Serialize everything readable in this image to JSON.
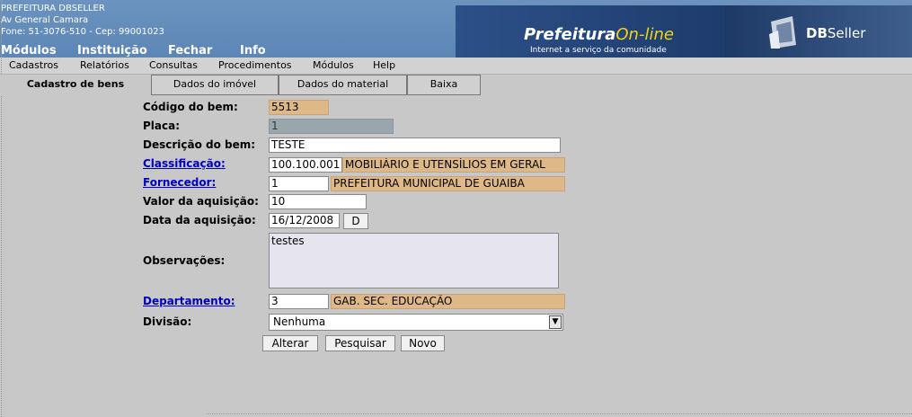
{
  "org": {
    "name": "PREFEITURA DBSELLER",
    "address": "Av General Camara",
    "contact": "Fone: 51-3076-510  -  Cep: 99001023"
  },
  "top_menu": [
    "Módulos",
    "Instituição",
    "Fechar",
    "Info"
  ],
  "logos": {
    "prefeitura_main": "Prefeitura",
    "prefeitura_accent": "On-line",
    "prefeitura_tagline": "Internet a serviço da comunidade",
    "dbseller_bold": "DB",
    "dbseller_rest": "Seller"
  },
  "menu_bar": [
    "Cadastros",
    "Relatórios",
    "Consultas",
    "Procedimentos",
    "Módulos",
    "Help"
  ],
  "tabs": [
    {
      "label": "Cadastro de bens",
      "active": true
    },
    {
      "label": "Dados do imóvel",
      "active": false
    },
    {
      "label": "Dados do material",
      "active": false
    },
    {
      "label": "Baixa",
      "active": false
    }
  ],
  "form": {
    "codigo": {
      "label": "Código do bem:",
      "value": "5513"
    },
    "placa": {
      "label": "Placa:",
      "value": "1"
    },
    "descricao": {
      "label": "Descrição do bem:",
      "value": "TESTE"
    },
    "classificacao": {
      "label": "Classificação:",
      "code": "100.100.001",
      "desc": "MOBILIÁRIO E UTENSÍLIOS EM GERAL"
    },
    "fornecedor": {
      "label": "Fornecedor:",
      "code": "1",
      "desc": "PREFEITURA MUNICIPAL DE GUAIBA"
    },
    "valor": {
      "label": "Valor da aquisição:",
      "value": "10"
    },
    "data": {
      "label": "Data da aquisição:",
      "value": "16/12/2008",
      "button": "D"
    },
    "observacoes": {
      "label": "Observações:",
      "value": "testes"
    },
    "departamento": {
      "label": "Departamento:",
      "code": "3",
      "desc": "GAB. SEC. EDUCAÇÃO"
    },
    "divisao": {
      "label": "Divisão:",
      "value": "Nenhuma"
    }
  },
  "buttons": {
    "alterar": "Alterar",
    "pesquisar": "Pesquisar",
    "novo": "Novo"
  },
  "colors": {
    "header": "#5c86b6",
    "readonly_field": "#deb887",
    "link": "#0000c0"
  }
}
